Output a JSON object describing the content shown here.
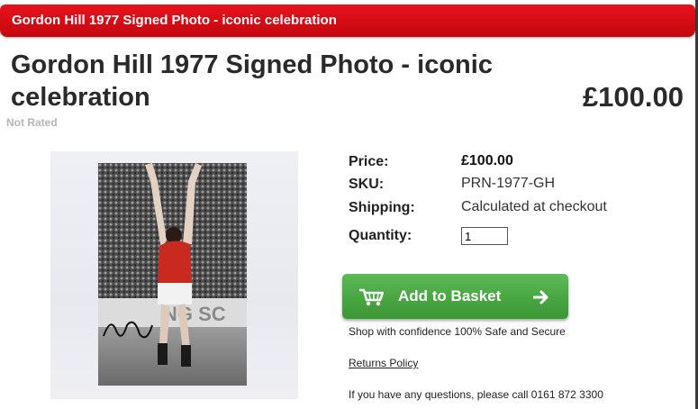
{
  "header": {
    "title": "Gordon Hill 1977 Signed Photo - iconic celebration"
  },
  "product": {
    "title": "Gordon Hill 1977 Signed Photo - iconic celebration",
    "price_display": "£100.00",
    "rating_text": "Not Rated",
    "image_overlay_text": "NG SC"
  },
  "details": {
    "price_label": "Price:",
    "price_value": "£100.00",
    "sku_label": "SKU:",
    "sku_value": "PRN-1977-GH",
    "shipping_label": "Shipping:",
    "shipping_value": "Calculated at checkout",
    "quantity_label": "Quantity:",
    "quantity_value": "1"
  },
  "actions": {
    "add_to_basket": "Add to Basket",
    "confidence_text": "Shop with confidence 100% Safe and Secure",
    "returns_link": "Returns Policy",
    "questions_text": "If you have any questions, please call 0161 872 3300"
  },
  "colors": {
    "title_bar": "#d40c14",
    "button_green": "#4aa844",
    "text": "#222222"
  },
  "icons": {
    "cart": "shopping-cart-icon",
    "arrow": "arrow-right-icon"
  }
}
